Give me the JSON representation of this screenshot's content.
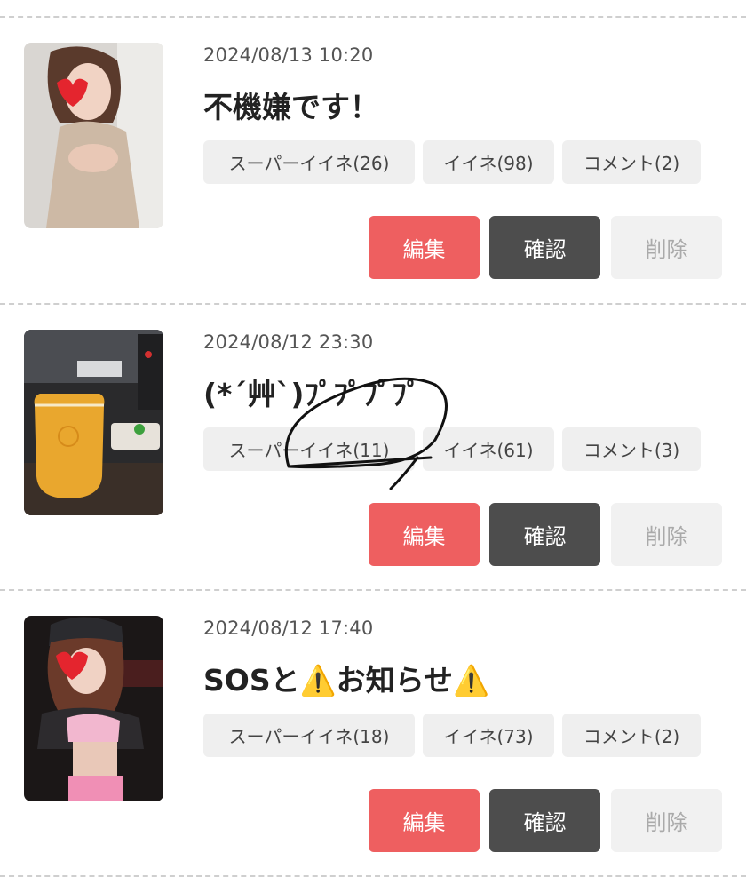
{
  "posts": [
    {
      "date": "2024/08/13 10:20",
      "title": "不機嫌です！",
      "super_like": "スーパーイイネ(26)",
      "like": "イイネ(98)",
      "comment": "コメント(2)",
      "edit": "編集",
      "confirm": "確認",
      "delete": "削除"
    },
    {
      "date": "2024/08/12 23:30",
      "title": "(*´艸`)ﾌﾟﾌﾟﾌﾟﾌﾟ",
      "super_like": "スーパーイイネ(11)",
      "like": "イイネ(61)",
      "comment": "コメント(3)",
      "edit": "編集",
      "confirm": "確認",
      "delete": "削除"
    },
    {
      "date": "2024/08/12 17:40",
      "title_parts": [
        "SOSと",
        "⚠️",
        "お知らせ",
        "⚠️"
      ],
      "super_like": "スーパーイイネ(18)",
      "like": "イイネ(73)",
      "comment": "コメント(2)",
      "edit": "編集",
      "confirm": "確認",
      "delete": "削除"
    }
  ],
  "colors": {
    "edit_bg": "#ee5f60",
    "confirm_bg": "#4d4d4d",
    "delete_bg": "#f1f1f1",
    "chip_bg": "#efefef"
  }
}
